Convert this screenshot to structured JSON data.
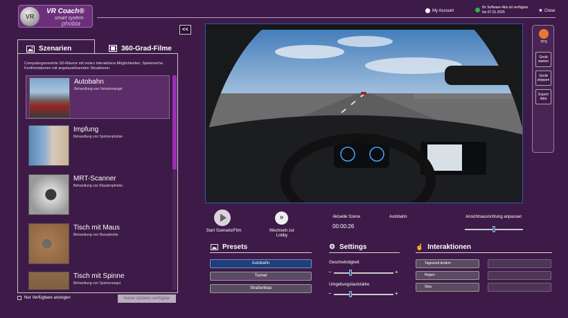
{
  "brand": {
    "line1": "VR Coach®",
    "line2": "smart system",
    "line3": "phobia",
    "disc_text": "VR"
  },
  "topbar": {
    "account_label": "My Account",
    "subscription_line1": "Ihr Software-Abo ist verfügbar",
    "subscription_line2": "bis 07.01.2025",
    "close_label": "Close"
  },
  "collapse_label": "<<",
  "tabs": [
    {
      "label": "Szenarien",
      "icon": "image-icon",
      "active": true
    },
    {
      "label": "360-Grad-Filme",
      "icon": "film-icon",
      "active": false
    }
  ],
  "panel": {
    "description": "Computergenerierte 3D-Räume mit vielen Interaktions-Möglichkeiten. Spielerische Konfrontationen mit angstauslösenden Situationen.",
    "items": [
      {
        "title": "Autobahn",
        "subtitle": "Behandlung von Verkehrsangst",
        "selected": true
      },
      {
        "title": "Impfung",
        "subtitle": "Behandlung von Spritzenphobie",
        "selected": false
      },
      {
        "title": "MRT-Scanner",
        "subtitle": "Behandlung von Klaustrophobie.",
        "selected": false
      },
      {
        "title": "Tisch mit Maus",
        "subtitle": "Behandlung von Musophobie",
        "selected": false
      },
      {
        "title": "Tisch mit Spinne",
        "subtitle": "Behandlung von Spinnenangst",
        "selected": false
      }
    ],
    "filter_label": "Nur Verfügbare anzeigen",
    "update_button": "Keine Updates verfügbar"
  },
  "right_panel": {
    "logo_text": "TPS",
    "buttons": [
      "Gerät starten",
      "Gerät stoppen",
      "Export data"
    ]
  },
  "controls": {
    "start_label": "Start Szenario/Film",
    "lobby_label": "Wechseln zur Lobby",
    "current_scene_label": "Aktuelle Szene",
    "current_scene_value": "Autobahn",
    "time": "00:00:26",
    "view_label": "Ansichtsausrichtung anpassen",
    "view_slider_value": 0.5
  },
  "presets": {
    "title": "Presets",
    "buttons": [
      {
        "label": "Autobahn",
        "active": true
      },
      {
        "label": "Tunnel",
        "active": false
      },
      {
        "label": "Straßenbau",
        "active": false
      }
    ]
  },
  "settings": {
    "title": "Settings",
    "speed_label": "Geschwindigkeit",
    "speed_value": 0.28,
    "volume_label": "Umgebungslautstärke",
    "volume_value": 0.28,
    "minus": "−",
    "plus": "+"
  },
  "interactions": {
    "title": "Interaktionen",
    "buttons": [
      "Tageszeit ändern",
      "Regen",
      "Stau"
    ]
  }
}
